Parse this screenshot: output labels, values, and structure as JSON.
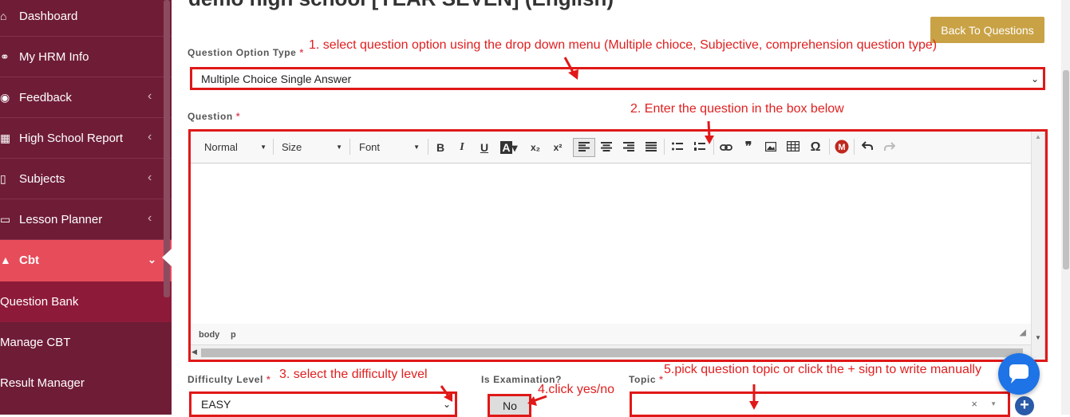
{
  "sidebar": {
    "items": [
      {
        "label": "Dashboard",
        "icon": "home-icon",
        "chevron": false
      },
      {
        "label": "My HRM Info",
        "icon": "user-icon",
        "chevron": false
      },
      {
        "label": "Feedback",
        "icon": "comments-icon",
        "chevron": true
      },
      {
        "label": "High School Report",
        "icon": "table-icon",
        "chevron": true
      },
      {
        "label": "Subjects",
        "icon": "book-icon",
        "chevron": true
      },
      {
        "label": "Lesson Planner",
        "icon": "tablet-icon",
        "chevron": true
      },
      {
        "label": "Cbt",
        "icon": "graduation-cap-icon",
        "chevron": true,
        "active": true
      }
    ],
    "subitems": [
      {
        "label": "Question Bank",
        "current": true
      },
      {
        "label": "Manage CBT"
      },
      {
        "label": "Result Manager"
      }
    ],
    "glyphs": {
      "chevron_left": "‹",
      "chevron_down": "⌄"
    }
  },
  "page": {
    "title": "demo high school [YEAR SEVEN] (English)",
    "back_button": "Back To Questions"
  },
  "form": {
    "question_option_type": {
      "label": "Question Option Type",
      "required": "*",
      "value": "Multiple Choice Single Answer"
    },
    "question": {
      "label": "Question",
      "required": "*"
    },
    "difficulty": {
      "label": "Difficulty Level",
      "required": "*",
      "value": "EASY"
    },
    "is_examination": {
      "label": "Is Examination?",
      "value": "No"
    },
    "topic": {
      "label": "Topic",
      "required": "*",
      "value": "",
      "clear": "×"
    }
  },
  "editor": {
    "format": "Normal",
    "size": "Size",
    "font": "Font",
    "path": [
      "body",
      "p"
    ],
    "buttons": {
      "bold": "B",
      "italic": "I",
      "underline": "U",
      "text_color": "A",
      "subscript": "x₂",
      "superscript": "x²",
      "quote": "❞",
      "special_char": "Ω"
    }
  },
  "annotations": {
    "step1": "1. select question option using the drop down menu (Multiple chioce, Subjective, comprehension question type)",
    "step2": "2. Enter the question in the box below",
    "step3": "3. select the difficulty level",
    "step4": "4.click yes/no",
    "step5": "5.pick question topic or click the + sign to write manually"
  },
  "colors": {
    "sidebar_bg": "#6f1d37",
    "active_item": "#e74c5a",
    "current_sub": "#8e1a3a",
    "back_button": "#c9a246",
    "annotation_red": "#e01818",
    "chat_button": "#1e73e6"
  }
}
